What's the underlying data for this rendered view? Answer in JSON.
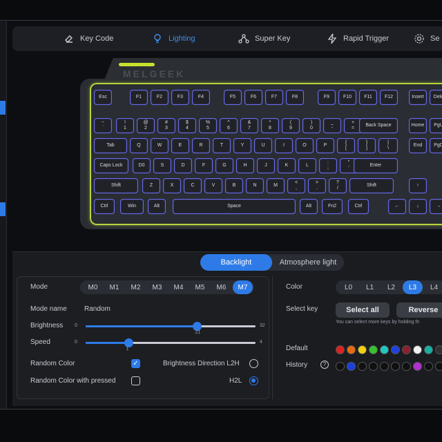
{
  "nav": {
    "items": [
      {
        "label": "Key Code",
        "icon": "key-code-icon"
      },
      {
        "label": "Lighting",
        "icon": "lightbulb-icon",
        "active": true
      },
      {
        "label": "Super Key",
        "icon": "super-key-icon"
      },
      {
        "label": "Rapid Trigger",
        "icon": "lightning-icon"
      },
      {
        "label": "Se",
        "icon": "gear-icon"
      }
    ]
  },
  "keyboard": {
    "brand": "MELGEEK",
    "key_border_color": "#6b6cf0",
    "rim_color": "#b8d43c",
    "rows": [
      [
        "Esc",
        "F1",
        "F2",
        "F3",
        "F4",
        "F5",
        "F6",
        "F7",
        "F8",
        "F9",
        "F10",
        "F11",
        "F12",
        "Insert",
        "Dele"
      ],
      [
        "~\n`",
        "!\n1",
        "@\n2",
        "#\n3",
        "$\n4",
        "%\n5",
        "^\n6",
        "&\n7",
        "*\n8",
        "(\n9",
        ")\n0",
        "_\n-",
        "+\n=",
        "Back Space",
        "Home",
        "PgU"
      ],
      [
        "Tab",
        "Q",
        "W",
        "E",
        "R",
        "T",
        "Y",
        "U",
        "I",
        "O",
        "P",
        "{\n[",
        "}\n]",
        "|\n\\",
        "End",
        "PgD"
      ],
      [
        "Caps Lock",
        "D0",
        "S",
        "D",
        "F",
        "G",
        "H",
        "J",
        "K",
        "L",
        ":\n;",
        "\"\n'",
        "Enter"
      ],
      [
        "Shift",
        "Z",
        "X",
        "C",
        "V",
        "B",
        "N",
        "M",
        "<\n,",
        ">\n.",
        "?\n/",
        "Shift",
        "↑"
      ],
      [
        "Ctrl",
        "Win",
        "Alt",
        "Space",
        "Alt",
        "Fn2",
        "Ctrl",
        "←",
        "↓",
        "→"
      ]
    ]
  },
  "panel": {
    "tabs": [
      "Backlight",
      "Atmosphere light"
    ],
    "active_tab": "Backlight",
    "mode": {
      "label": "Mode",
      "options": [
        "M0",
        "M1",
        "M2",
        "M3",
        "M4",
        "M5",
        "M6",
        "M7"
      ],
      "selected": "M7"
    },
    "mode_name": {
      "label": "Mode name",
      "value": "Random"
    },
    "brightness": {
      "label": "Brightness",
      "min": "0",
      "max": "32",
      "value": 21,
      "value_text": "21"
    },
    "speed": {
      "label": "Speed",
      "min": "0",
      "max": "4",
      "value": 1,
      "value_text": "1"
    },
    "random_color": {
      "label": "Random Color",
      "checked": true
    },
    "random_color_pressed": {
      "label": "Random Color with pressed",
      "checked": false
    },
    "brightness_direction": {
      "label": "Brightness Direction L2H",
      "checked": false
    },
    "h2l": {
      "label": "H2L",
      "checked": true
    },
    "color": {
      "label": "Color",
      "layers": [
        "L0",
        "L1",
        "L2",
        "L3",
        "L4"
      ],
      "selected": "L3"
    },
    "select_key": {
      "label": "Select key",
      "select_all": "Select all",
      "reverse": "Reverse",
      "hint": "You can select more keys by holding th"
    },
    "default": {
      "label": "Default",
      "colors": [
        "#e02020",
        "#e86a10",
        "#f0d010",
        "#38c030",
        "#20c8c0",
        "#2040e0",
        "#8a2030",
        "#f0f0f0",
        "#18b0a0",
        "#303030"
      ]
    },
    "history": {
      "label": "History",
      "colors": [
        "#101010",
        "#1a40e0",
        "#101010",
        "#101010",
        "#101010",
        "#101010",
        "#101010",
        "#b030d0",
        "#101010",
        "#101010",
        "#101010"
      ]
    },
    "accent": "#2e7be8"
  }
}
